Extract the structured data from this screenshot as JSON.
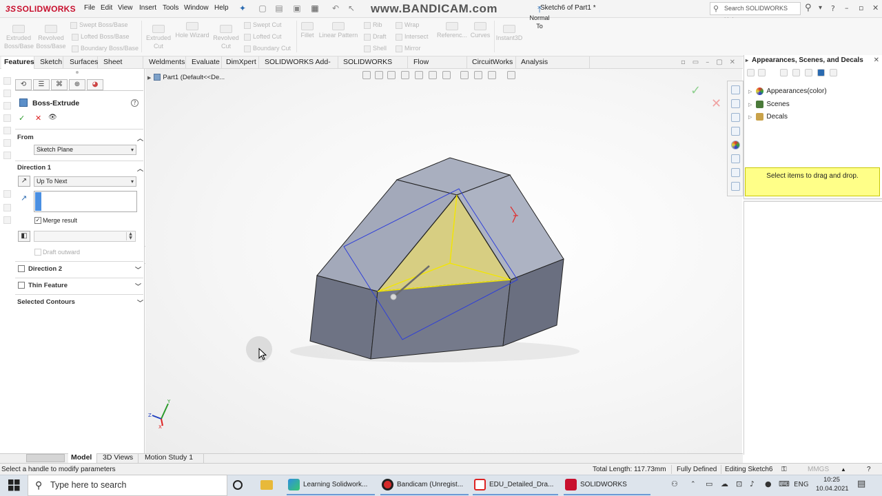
{
  "app": {
    "logo": "SOLIDWORKS",
    "menus": [
      "File",
      "Edit",
      "View",
      "Insert",
      "Tools",
      "Window",
      "Help"
    ],
    "document_title": "Sketch6 of Part1 *",
    "watermark": "www.BANDICAM.com",
    "search_placeholder": "Search SOLIDWORKS Help"
  },
  "commands": {
    "extruded_boss": "Extruded Boss/Base",
    "revolved_boss": "Revolved Boss/Base",
    "swept_boss": "Swept Boss/Base",
    "lofted_boss": "Lofted Boss/Base",
    "boundary_boss": "Boundary Boss/Base",
    "extruded_cut": "Extruded Cut",
    "hole_wizard": "Hole Wizard",
    "revolved_cut": "Revolved Cut",
    "swept_cut": "Swept Cut",
    "lofted_cut": "Lofted Cut",
    "boundary_cut": "Boundary Cut",
    "fillet": "Fillet",
    "linear_pattern": "Linear Pattern",
    "rib": "Rib",
    "draft": "Draft",
    "shell": "Shell",
    "wrap": "Wrap",
    "intersect": "Intersect",
    "mirror": "Mirror",
    "reference": "Referenc...",
    "curves": "Curves",
    "instant3d": "Instant3D",
    "normal_to": "Normal To"
  },
  "tabs": [
    "Features",
    "Sketch",
    "Surfaces",
    "Sheet Metal",
    "Weldments",
    "Evaluate",
    "DimXpert",
    "SOLIDWORKS Add-Ins",
    "SOLIDWORKS MBD",
    "Flow Simulation",
    "CircuitWorks",
    "Analysis Preparation"
  ],
  "property_manager": {
    "title": "Boss-Extrude",
    "from_label": "From",
    "from_value": "Sketch Plane",
    "direction1_label": "Direction 1",
    "direction1_value": "Up To Next",
    "merge_result": "Merge result",
    "draft_outward": "Draft outward",
    "direction2_label": "Direction 2",
    "thin_feature_label": "Thin Feature",
    "selected_contours_label": "Selected Contours"
  },
  "graphics": {
    "tree_root": "Part1  (Default<<De..."
  },
  "task_pane": {
    "title": "Appearances, Scenes, and Decals",
    "items": [
      "Appearances(color)",
      "Scenes",
      "Decals"
    ],
    "drop_hint": "Select items to drag and drop."
  },
  "bottom_tabs": [
    "Model",
    "3D Views",
    "Motion Study 1"
  ],
  "status": {
    "message": "Select a handle to modify parameters",
    "total_length": "Total Length: 117.73mm",
    "definition": "Fully Defined",
    "editing": "Editing Sketch6",
    "units": "MMGS"
  },
  "taskbar": {
    "search_placeholder": "Type here to search",
    "apps": [
      "Learning Solidwork...",
      "Bandicam (Unregist...",
      "EDU_Detailed_Dra...",
      "SOLIDWORKS Prem..."
    ],
    "language": "ENG",
    "time": "10:25",
    "date": "10.04.2021"
  },
  "colors": {
    "brand_red": "#c8102e",
    "model_face_light": "#a9afbf",
    "model_face_dark": "#6e7384",
    "sketch_fill": "#d7ce82",
    "sketch_line": "#f3e600",
    "selection_blue": "#2f3fd8",
    "tooltip_yellow": "#ffff88"
  }
}
